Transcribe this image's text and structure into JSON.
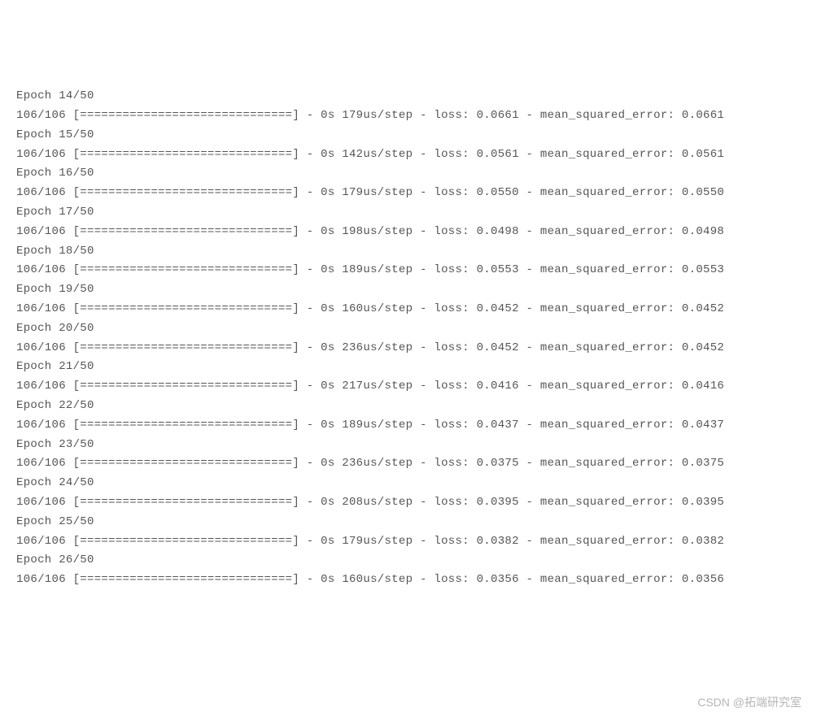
{
  "log": {
    "total_epochs": "50",
    "batch_total": "106",
    "bar": "[==============================]",
    "time_prefix": "0s",
    "step_unit": "us/step",
    "loss_label": "loss:",
    "mse_label": "mean_squared_error:",
    "entries": [
      {
        "epoch": "14",
        "step": "179",
        "loss": "0.0661",
        "mse": "0.0661"
      },
      {
        "epoch": "15",
        "step": "142",
        "loss": "0.0561",
        "mse": "0.0561"
      },
      {
        "epoch": "16",
        "step": "179",
        "loss": "0.0550",
        "mse": "0.0550"
      },
      {
        "epoch": "17",
        "step": "198",
        "loss": "0.0498",
        "mse": "0.0498"
      },
      {
        "epoch": "18",
        "step": "189",
        "loss": "0.0553",
        "mse": "0.0553"
      },
      {
        "epoch": "19",
        "step": "160",
        "loss": "0.0452",
        "mse": "0.0452"
      },
      {
        "epoch": "20",
        "step": "236",
        "loss": "0.0452",
        "mse": "0.0452"
      },
      {
        "epoch": "21",
        "step": "217",
        "loss": "0.0416",
        "mse": "0.0416"
      },
      {
        "epoch": "22",
        "step": "189",
        "loss": "0.0437",
        "mse": "0.0437"
      },
      {
        "epoch": "23",
        "step": "236",
        "loss": "0.0375",
        "mse": "0.0375"
      },
      {
        "epoch": "24",
        "step": "208",
        "loss": "0.0395",
        "mse": "0.0395"
      },
      {
        "epoch": "25",
        "step": "179",
        "loss": "0.0382",
        "mse": "0.0382"
      },
      {
        "epoch": "26",
        "step": "160",
        "loss": "0.0356",
        "mse": "0.0356"
      }
    ]
  },
  "watermark": "CSDN @拓端研究室"
}
